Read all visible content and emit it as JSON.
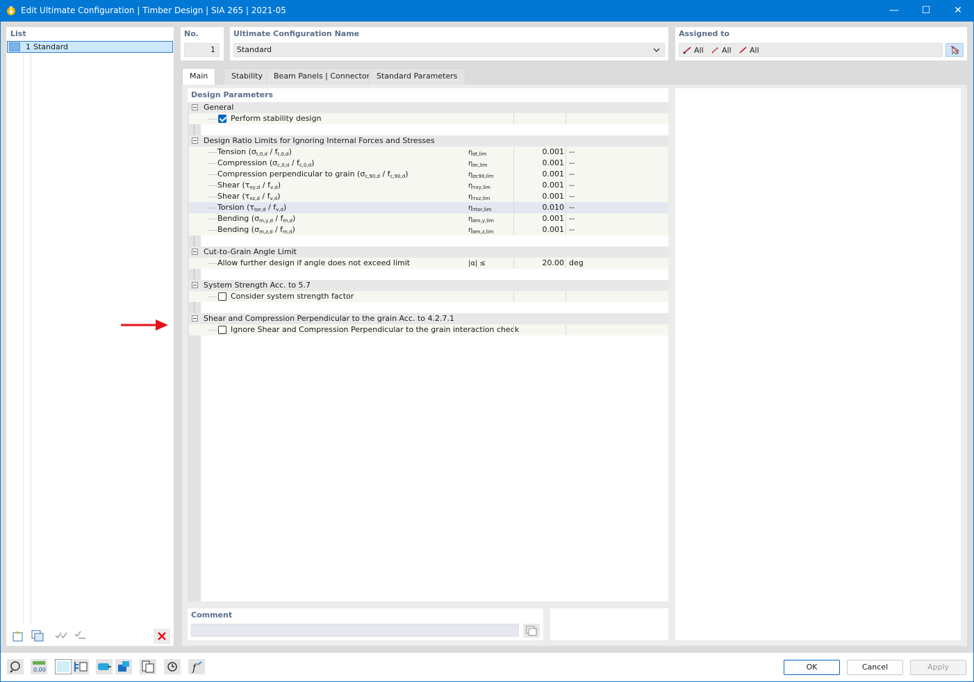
{
  "window": {
    "title": "Edit Ultimate Configuration | Timber Design | SIA 265 | 2021-05",
    "minimize": "—",
    "maximize": "☐",
    "close": "✕"
  },
  "list": {
    "label": "List",
    "items": [
      {
        "number": "1",
        "name": "Standard"
      }
    ]
  },
  "header": {
    "no_label": "No.",
    "no_value": "1",
    "name_label": "Ultimate Configuration Name",
    "name_value": "Standard",
    "assigned_label": "Assigned to",
    "assigned": [
      "All",
      "All",
      "All"
    ]
  },
  "tabs": [
    "Main",
    "Stability",
    "Beam Panels | Connectors",
    "Standard Parameters"
  ],
  "design_parameters": {
    "label": "Design Parameters",
    "groups": [
      {
        "title": "General",
        "checks": [
          {
            "label": "Perform stability design",
            "checked": true
          }
        ]
      },
      {
        "title": "Design Ratio Limits for Ignoring Internal Forces and Stresses",
        "rows": [
          {
            "label": "Tension (",
            "f1": "σ",
            "s1": "t,0,d",
            "mid": " / f",
            "s2": "t,0,d",
            "end": ")",
            "symbol": "η",
            "symsub": "σt,lim",
            "value": "0.001",
            "unit": "--"
          },
          {
            "label": "Compression (",
            "f1": "σ",
            "s1": "c,0,d",
            "mid": " / f",
            "s2": "c,0,d",
            "end": ")",
            "symbol": "η",
            "symsub": "σc,lim",
            "value": "0.001",
            "unit": "--"
          },
          {
            "label": "Compression perpendicular to grain (",
            "f1": "σ",
            "s1": "c,90,d",
            "mid": " / f",
            "s2": "c,90,d",
            "end": ")",
            "symbol": "η",
            "symsub": "σc90,lim",
            "value": "0.001",
            "unit": "--"
          },
          {
            "label": "Shear (",
            "f1": "τ",
            "s1": "xy,d",
            "mid": " / f",
            "s2": "v,d",
            "end": ")",
            "symbol": "η",
            "symsub": "τxy,lim",
            "value": "0.001",
            "unit": "--"
          },
          {
            "label": "Shear (",
            "f1": "τ",
            "s1": "xz,d",
            "mid": " / f",
            "s2": "v,d",
            "end": ")",
            "symbol": "η",
            "symsub": "τxz,lim",
            "value": "0.001",
            "unit": "--"
          },
          {
            "label": "Torsion (",
            "f1": "τ",
            "s1": "tor,d",
            "mid": " / f",
            "s2": "v,d",
            "end": ")",
            "symbol": "η",
            "symsub": "τtor,lim",
            "value": "0.010",
            "unit": "--"
          },
          {
            "label": "Bending (",
            "f1": "σ",
            "s1": "m,y,d",
            "mid": " / f",
            "s2": "m,d",
            "end": ")",
            "symbol": "η",
            "symsub": "σm,y,lim",
            "value": "0.001",
            "unit": "--"
          },
          {
            "label": "Bending (",
            "f1": "σ",
            "s1": "m,z,d",
            "mid": " / f",
            "s2": "m,d",
            "end": ")",
            "symbol": "η",
            "symsub": "σm,z,lim",
            "value": "0.001",
            "unit": "--"
          }
        ]
      },
      {
        "title": "Cut-to-Grain Angle Limit",
        "rows": [
          {
            "label": "Allow further design if angle does not exceed limit",
            "symbol": "|α| ≤",
            "value": "20.00",
            "unit": "deg"
          }
        ]
      },
      {
        "title": "System Strength Acc. to 5.7",
        "checks": [
          {
            "label": "Consider system strength factor",
            "checked": false
          }
        ]
      },
      {
        "title": "Shear and Compression Perpendicular to the grain Acc. to 4.2.7.1",
        "checks": [
          {
            "label": "Ignore Shear and Compression Perpendicular to the grain interaction check",
            "checked": false
          }
        ]
      }
    ]
  },
  "comment": {
    "label": "Comment",
    "value": ""
  },
  "buttons": {
    "ok": "OK",
    "cancel": "Cancel",
    "apply": "Apply"
  },
  "status_icons": [
    "help-icon",
    "units-icon",
    "color-icon",
    "display-icon",
    "view-icon",
    "model-icon",
    "library-icon",
    "reset-icon",
    "function-icon"
  ],
  "colors": {
    "titlebar": "#0078d4",
    "selection": "#cce8ff",
    "arrow": "#e8101a",
    "checkbox": "#0067c0"
  }
}
